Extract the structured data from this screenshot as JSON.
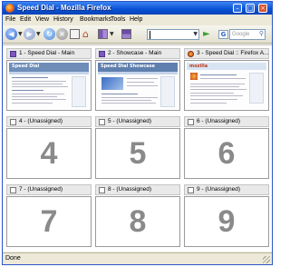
{
  "window": {
    "title": "Speed Dial - Mozilla Firefox",
    "controls": [
      "minimize-icon",
      "maximize-icon",
      "close-icon"
    ]
  },
  "menu": [
    "File",
    "Edit",
    "View",
    "History",
    "Bookmarks",
    "Tools",
    "Help"
  ],
  "toolbar": {
    "address_value": "",
    "search_placeholder": "Google",
    "search_engine_icon": "G"
  },
  "dials": [
    {
      "label": "1 - Speed Dial - Main",
      "number": "",
      "thumb_title": "Speed Dial"
    },
    {
      "label": "2 - Showcase - Main",
      "number": "",
      "thumb_title": "Speed Dial Showcase"
    },
    {
      "label": "3 - Speed Dial :: Firefox A...",
      "number": "",
      "thumb_title": "mozilla"
    },
    {
      "label": "4 - (Unassigned)",
      "number": "4"
    },
    {
      "label": "5 - (Unassigned)",
      "number": "5"
    },
    {
      "label": "6 - (Unassigned)",
      "number": "6"
    },
    {
      "label": "7 - (Unassigned)",
      "number": "7"
    },
    {
      "label": "8 - (Unassigned)",
      "number": "8"
    },
    {
      "label": "9 - (Unassigned)",
      "number": "9"
    }
  ],
  "status": {
    "text": "Done"
  },
  "colors": {
    "titlebar": "#0a52d6",
    "chrome": "#ece9d8",
    "digit": "#8a8a8a"
  }
}
